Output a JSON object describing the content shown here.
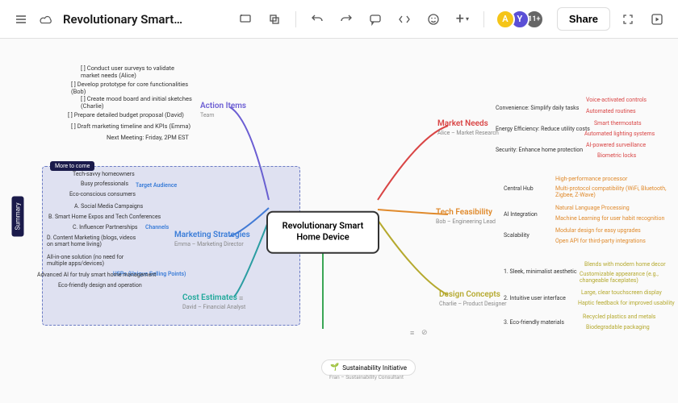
{
  "header": {
    "title": "Revolutionary Smart…",
    "avatars": {
      "a": "A",
      "y": "Y",
      "more": "11+"
    },
    "share": "Share"
  },
  "center": {
    "title": "Revolutionary Smart Home Device"
  },
  "action_items": {
    "label": "Action Items",
    "sub": "Team",
    "items": [
      "[ ] Conduct user surveys to validate market needs (Alice)",
      "[ ] Develop prototype for core functionalities (Bob)",
      "[ ] Create mood board and initial sketches (Charlie)",
      "[ ] Prepare detailed budget proposal (David)",
      "[ ] Draft marketing timeline and KPIs (Emma)",
      "Next Meeting: Friday, 2PM EST"
    ]
  },
  "marketing": {
    "label": "Marketing Strategies",
    "sub": "Emma – Marketing Director",
    "target": {
      "label": "Target Audience",
      "items": [
        "Tech-savvy homeowners",
        "Busy professionals",
        "Eco-conscious consumers"
      ]
    },
    "channels": {
      "label": "Channels",
      "items": [
        "A.   Social Media Campaigns",
        "B.   Smart Home Expos and Tech Conferences",
        "C.   Influencer Partnerships",
        "D.   Content Marketing (blogs, videos on smart home living)"
      ]
    },
    "usp": {
      "label": "USPs (Unique Selling Points)",
      "items": [
        "All-in-one solution (no need for multiple apps/devices)",
        "Advanced AI for truly smart home management",
        "Eco-friendly design and operation"
      ]
    }
  },
  "cost": {
    "label": "Cost Estimates",
    "sub": "David – Financial Analyst"
  },
  "market_needs": {
    "label": "Market Needs",
    "sub": "Alice – Market Research",
    "items": [
      {
        "k": "Convenience: Simplify daily tasks",
        "leaves": [
          "Voice-activated controls",
          "Automated routines"
        ]
      },
      {
        "k": "Energy Efficiency: Reduce utility costs",
        "leaves": [
          "Smart thermostats",
          "Automated lighting systems"
        ]
      },
      {
        "k": "Security: Enhance home protection",
        "leaves": [
          "AI-powered surveillance",
          "Biometric locks"
        ]
      }
    ]
  },
  "tech": {
    "label": "Tech Feasibility",
    "sub": "Bob – Engineering Lead",
    "items": [
      {
        "k": "Central Hub",
        "leaves": [
          "High-performance processor",
          "Multi-protocol compatibility (WiFi, Bluetooth, Zigbee, Z-Wave)"
        ]
      },
      {
        "k": "AI Integration",
        "leaves": [
          "Natural Language Processing",
          "Machine Learning for user habit recognition"
        ]
      },
      {
        "k": "Scalability",
        "leaves": [
          "Modular design for easy upgrades",
          "Open API for third-party integrations"
        ]
      }
    ]
  },
  "design": {
    "label": "Design Concepts",
    "sub": "Charlie – Product Designer",
    "items": [
      {
        "k": "1. Sleek, minimalist aesthetic",
        "leaves": [
          "Blends with modern home decor",
          "Customizable appearance (e.g., changeable faceplates)"
        ]
      },
      {
        "k": "2. Intuitive user interface",
        "leaves": [
          "Large, clear touchscreen display",
          "Haptic feedback for improved usability"
        ]
      },
      {
        "k": "3. Eco-friendly materials",
        "leaves": [
          "Recycled plastics and metals",
          "Biodegradable packaging"
        ]
      }
    ]
  },
  "sustainability": {
    "label": "Sustainability Initiative",
    "sub": "Fran – Sustainability Consultant"
  },
  "tags": {
    "summary": "Summary",
    "more": "More to come"
  }
}
